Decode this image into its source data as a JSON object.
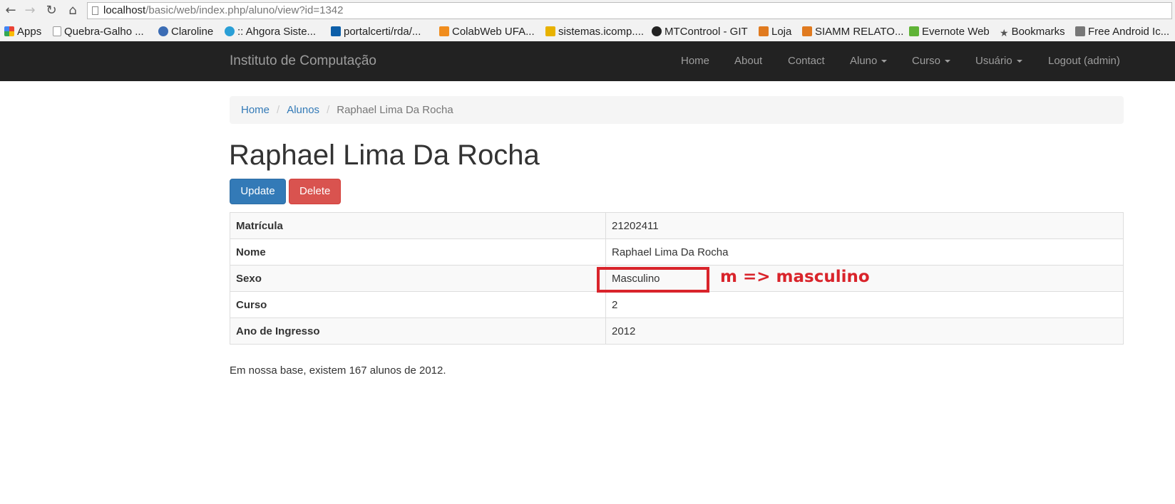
{
  "browser": {
    "url_host": "localhost",
    "url_path": "/basic/web/index.php/aluno/view?id=1342",
    "bookmarks": [
      {
        "label": "Apps",
        "color": "#e94235"
      },
      {
        "label": "Quebra-Galho ...",
        "color": "#999999"
      },
      {
        "label": "Claroline",
        "color": "#3b6cb4"
      },
      {
        "label": ":: Ahgora Siste...",
        "color": "#2a9fd6"
      },
      {
        "label": "portalcerti/rda/...",
        "color": "#0c5ea8"
      },
      {
        "label": "ColabWeb UFA...",
        "color": "#f08d1e"
      },
      {
        "label": "sistemas.icomp....",
        "color": "#e8b200"
      },
      {
        "label": "MTControol - GIT",
        "color": "#222222"
      },
      {
        "label": "Loja",
        "color": "#e07a1f"
      },
      {
        "label": "SIAMM RELATO...",
        "color": "#e07a1f"
      },
      {
        "label": "Evernote Web",
        "color": "#5fb336"
      },
      {
        "label": "Bookmarks",
        "color": "#555555"
      },
      {
        "label": "Free Android Ic...",
        "color": "#777777"
      }
    ]
  },
  "navbar": {
    "brand": "Instituto de Computação",
    "links": [
      {
        "label": "Home",
        "dropdown": false
      },
      {
        "label": "About",
        "dropdown": false
      },
      {
        "label": "Contact",
        "dropdown": false
      },
      {
        "label": "Aluno",
        "dropdown": true
      },
      {
        "label": "Curso",
        "dropdown": true
      },
      {
        "label": "Usuário",
        "dropdown": true
      },
      {
        "label": "Logout (admin)",
        "dropdown": false
      }
    ]
  },
  "breadcrumb": {
    "home": "Home",
    "alunos": "Alunos",
    "current": "Raphael Lima Da Rocha"
  },
  "page": {
    "title": "Raphael Lima Da Rocha",
    "update_label": "Update",
    "delete_label": "Delete"
  },
  "detail": {
    "rows": [
      {
        "label": "Matrícula",
        "value": "21202411"
      },
      {
        "label": "Nome",
        "value": "Raphael Lima Da Rocha"
      },
      {
        "label": "Sexo",
        "value": "Masculino"
      },
      {
        "label": "Curso",
        "value": "2"
      },
      {
        "label": "Ano de Ingresso",
        "value": "2012"
      }
    ]
  },
  "annotation": "m => masculino",
  "footnote": "Em nossa base, existem 167 alunos de 2012.",
  "colors": {
    "navbar_bg": "#222222",
    "primary": "#337ab7",
    "danger": "#d9534f",
    "annotation": "#d9242b"
  }
}
